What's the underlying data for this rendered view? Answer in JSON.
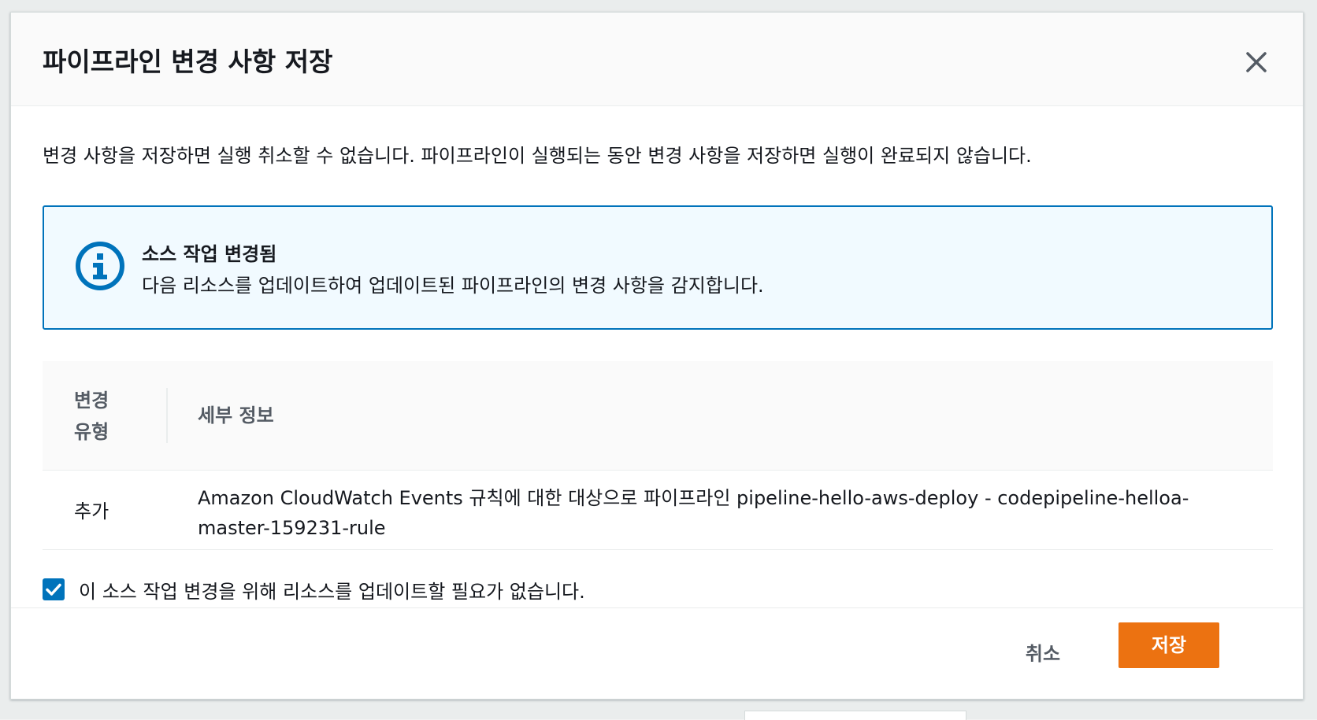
{
  "modal": {
    "title": "파이프라인 변경 사항 저장",
    "intro": "변경 사항을 저장하면 실행 취소할 수 없습니다. 파이프라인이 실행되는 동안 변경 사항을 저장하면 실행이 완료되지 않습니다.",
    "alert": {
      "title": "소스 작업 변경됨",
      "text": "다음 리소스를 업데이트하여 업데이트된 파이프라인의 변경 사항을 감지합니다.",
      "icon": "info-icon"
    },
    "table": {
      "headers": {
        "type": "변경 유형",
        "detail": "세부 정보"
      },
      "rows": [
        {
          "type": "추가",
          "detail": "Amazon CloudWatch Events 규칙에 대한 대상으로 파이프라인 pipeline-hello-aws-deploy - codepipeline-helloa-master-159231-rule"
        }
      ]
    },
    "checkbox": {
      "label": "이 소스 작업 변경을 위해 리소스를 업데이트할 필요가 없습니다.",
      "checked": true
    },
    "footer": {
      "cancel_label": "취소",
      "save_label": "저장"
    }
  },
  "colors": {
    "accent": "#0073bb",
    "primary_button": "#ec7211",
    "alert_bg": "#f1faff"
  }
}
